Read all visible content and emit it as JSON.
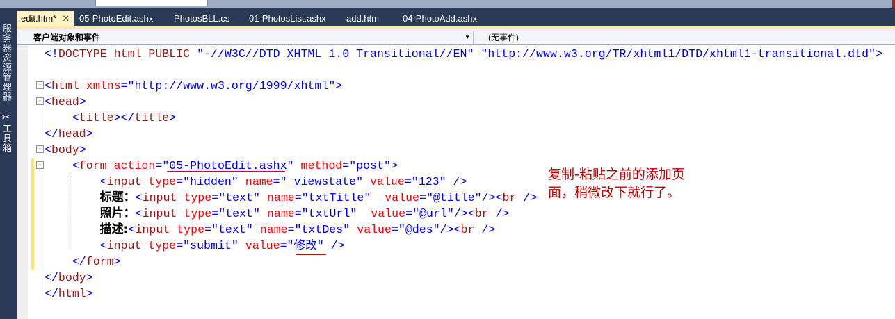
{
  "tabs": [
    {
      "label": "edit.htm*",
      "active": true
    },
    {
      "label": "05-PhotoEdit.ashx"
    },
    {
      "label": "PhotosBLL.cs"
    },
    {
      "label": "01-PhotosList.ashx"
    },
    {
      "label": "add.htm"
    },
    {
      "label": "04-PhotoAdd.ashx"
    }
  ],
  "close_glyph": "✕",
  "sidebar": {
    "server_explorer": "服务器资源管理器",
    "toolbox": "工具箱"
  },
  "dropdowns": {
    "objects": "客户端对象和事件",
    "events": "(无事件)"
  },
  "code_lines": [
    [
      [
        "<!",
        "t"
      ],
      [
        "DOCTYPE html PUBLIC",
        "e"
      ],
      [
        " ",
        ""
      ],
      [
        "\"-//W3C//DTD XHTML 1.0 Transitional//EN\"",
        "v"
      ],
      [
        " \"",
        "v"
      ],
      [
        "http://www.w3.org/TR/xhtml1/DTD/xhtml1-transitional.dtd",
        "u"
      ],
      [
        "\">",
        "t"
      ]
    ],
    [],
    [
      [
        "<",
        "t"
      ],
      [
        "html",
        "e"
      ],
      [
        " xmlns",
        "a"
      ],
      [
        "=\"",
        "t"
      ],
      [
        "http://www.w3.org/1999/xhtml",
        "u"
      ],
      [
        "\">",
        "t"
      ]
    ],
    [
      [
        "<",
        "t"
      ],
      [
        "head",
        "e"
      ],
      [
        ">",
        "t"
      ]
    ],
    [
      [
        "    <",
        "t"
      ],
      [
        "title",
        "e"
      ],
      [
        "></",
        "t"
      ],
      [
        "title",
        "e"
      ],
      [
        ">",
        "t"
      ]
    ],
    [
      [
        "</",
        "t"
      ],
      [
        "head",
        "e"
      ],
      [
        ">",
        "t"
      ]
    ],
    [
      [
        "<",
        "t"
      ],
      [
        "body",
        "e"
      ],
      [
        ">",
        "t"
      ]
    ],
    [
      [
        "    <",
        "t"
      ],
      [
        "form",
        "e"
      ],
      [
        " action",
        "a"
      ],
      [
        "=\"",
        "t"
      ],
      [
        "05-PhotoEdit.ashx",
        "u"
      ],
      [
        "\"",
        "t"
      ],
      [
        " method",
        "a"
      ],
      [
        "=\"post\">",
        "t"
      ]
    ],
    [
      [
        "        <",
        "t"
      ],
      [
        "input",
        "e"
      ],
      [
        " type",
        "a"
      ],
      [
        "=\"hidden\"",
        "t"
      ],
      [
        " name",
        "a"
      ],
      [
        "=\"_viewstate\"",
        "t"
      ],
      [
        " value",
        "a"
      ],
      [
        "=\"123\" />",
        "t"
      ]
    ],
    [
      [
        "        ",
        ""
      ],
      [
        "标题：",
        "c"
      ],
      [
        "<",
        "t"
      ],
      [
        "input",
        "e"
      ],
      [
        " type",
        "a"
      ],
      [
        "=\"text\"",
        "t"
      ],
      [
        " name",
        "a"
      ],
      [
        "=\"txtTitle\"",
        "t"
      ],
      [
        "  value",
        "a"
      ],
      [
        "=\"@title\"/><",
        "t"
      ],
      [
        "br",
        "e"
      ],
      [
        " />",
        "t"
      ]
    ],
    [
      [
        "        ",
        ""
      ],
      [
        "照片：",
        "c"
      ],
      [
        "<",
        "t"
      ],
      [
        "input",
        "e"
      ],
      [
        " type",
        "a"
      ],
      [
        "=\"text\"",
        "t"
      ],
      [
        " name",
        "a"
      ],
      [
        "=\"txtUrl\"",
        "t"
      ],
      [
        "  value",
        "a"
      ],
      [
        "=\"@url\"/><",
        "t"
      ],
      [
        "br",
        "e"
      ],
      [
        " />",
        "t"
      ]
    ],
    [
      [
        "        ",
        ""
      ],
      [
        "描述:",
        "c"
      ],
      [
        "<",
        "t"
      ],
      [
        "input",
        "e"
      ],
      [
        " type",
        "a"
      ],
      [
        "=\"text\"",
        "t"
      ],
      [
        " name",
        "a"
      ],
      [
        "=\"txtDes\"",
        "t"
      ],
      [
        " value",
        "a"
      ],
      [
        "=\"@des\"/><",
        "t"
      ],
      [
        "br",
        "e"
      ],
      [
        " />",
        "t"
      ]
    ],
    [
      [
        "        <",
        "t"
      ],
      [
        "input",
        "e"
      ],
      [
        " type",
        "a"
      ],
      [
        "=\"submit\"",
        "t"
      ],
      [
        " value",
        "a"
      ],
      [
        "=\"",
        "t"
      ],
      [
        "修改",
        "u"
      ],
      [
        "\" />",
        "t"
      ]
    ],
    [
      [
        "    </",
        "t"
      ],
      [
        "form",
        "e"
      ],
      [
        ">",
        "t"
      ]
    ],
    [
      [
        "</",
        "t"
      ],
      [
        "body",
        "e"
      ],
      [
        ">",
        "t"
      ]
    ],
    [
      [
        "</",
        "t"
      ],
      [
        "html",
        "e"
      ],
      [
        ">",
        "t"
      ]
    ]
  ],
  "annotation": {
    "line1": "复制-粘贴之前的添加页",
    "line2": "面，稍微改下就行了。"
  }
}
